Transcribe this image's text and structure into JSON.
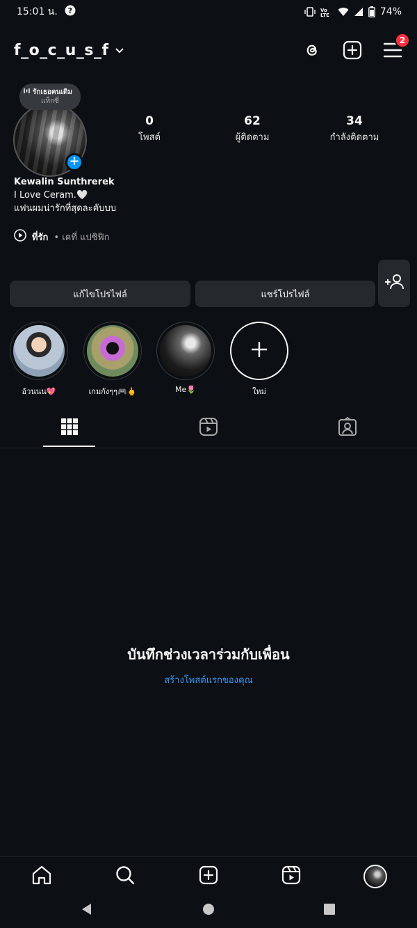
{
  "status_bar": {
    "time": "15:01 น.",
    "battery": "74%",
    "network_label": "VoLTE"
  },
  "header": {
    "username": "f_o_c_u_s_f",
    "notification_count": "2",
    "icons": [
      "threads-icon",
      "create-post-icon",
      "menu-icon"
    ]
  },
  "note": {
    "line1": "รักเธอคนเดิม",
    "line2": "แท็กซี่"
  },
  "stats": [
    {
      "value": "0",
      "label": "โพสต์"
    },
    {
      "value": "62",
      "label": "ผู้ติดตาม"
    },
    {
      "value": "34",
      "label": "กำลังติดตาม"
    }
  ],
  "bio": {
    "name": "Kewalin Sunthrerek",
    "line1": "I Love Ceram.🤍",
    "line2": "แฟนผมน่ารักที่สุดละคับบบ"
  },
  "music": {
    "title": "ที่รัก",
    "artist": "• เคที่ แปซิฟิก"
  },
  "buttons": {
    "edit_profile": "แก้ไขโปรไฟล์",
    "share_profile": "แชร์โปรไฟล์"
  },
  "highlights": [
    {
      "label": "อ้วนนน💖"
    },
    {
      "label": "เกมกังๆๆ🎮🖕"
    },
    {
      "label": "Me🌷"
    },
    {
      "label": "ใหม่"
    }
  ],
  "empty_state": {
    "title": "บันทึกช่วงเวลาร่วมกับเพื่อน",
    "link": "สร้างโพสต์แรกของคุณ"
  },
  "colors": {
    "background": "#0c1014",
    "accent": "#0095f6",
    "badge": "#ff3040",
    "link": "#3897f0",
    "button_bg": "#25292e"
  }
}
